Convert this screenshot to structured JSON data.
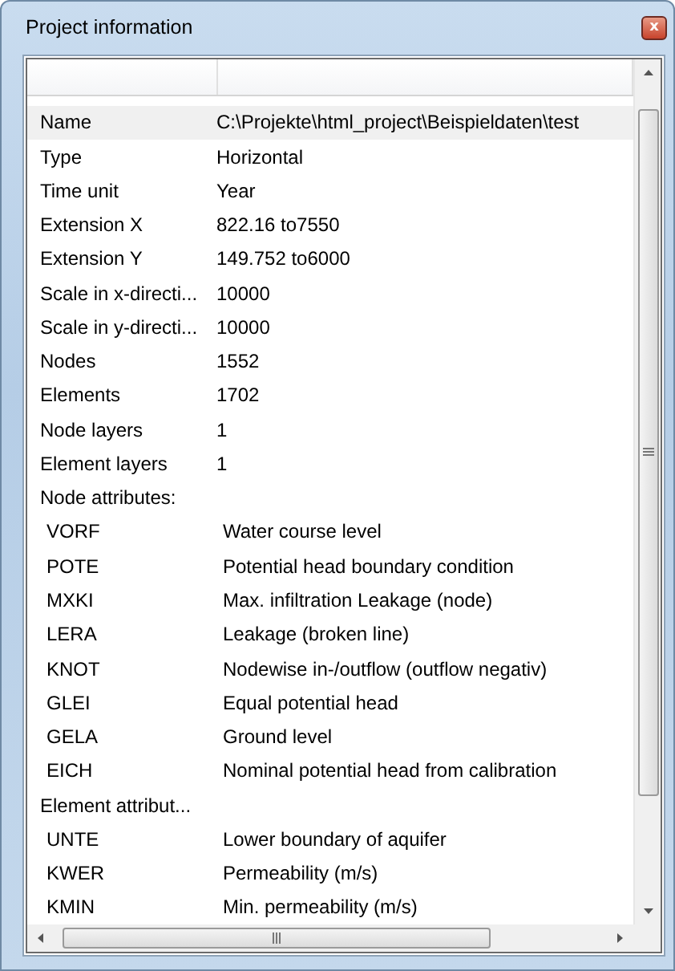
{
  "window": {
    "title": "Project information",
    "close_label": "x"
  },
  "list": {
    "rows": [
      {
        "kind": "property",
        "label": "Name",
        "value": "C:\\Projekte\\html_project\\Beispieldaten\\test",
        "selected": true
      },
      {
        "kind": "property",
        "label": "Type",
        "value": "Horizontal",
        "selected": false
      },
      {
        "kind": "property",
        "label": "Time unit",
        "value": "Year",
        "selected": false
      },
      {
        "kind": "property",
        "label": "Extension X",
        "value": "822.16 to7550",
        "selected": false
      },
      {
        "kind": "property",
        "label": "Extension Y",
        "value": "149.752 to6000",
        "selected": false
      },
      {
        "kind": "property",
        "label": "Scale in x-directi...",
        "value": "10000",
        "selected": false
      },
      {
        "kind": "property",
        "label": "Scale in y-directi...",
        "value": "10000",
        "selected": false
      },
      {
        "kind": "property",
        "label": "Nodes",
        "value": "1552",
        "selected": false
      },
      {
        "kind": "property",
        "label": "Elements",
        "value": "1702",
        "selected": false
      },
      {
        "kind": "property",
        "label": "Node layers",
        "value": "1",
        "selected": false
      },
      {
        "kind": "property",
        "label": "Element layers",
        "value": "1",
        "selected": false
      },
      {
        "kind": "section",
        "label": "Node attributes:",
        "selected": false
      },
      {
        "kind": "attribute",
        "label": "VORF",
        "value": "Water course level",
        "selected": false
      },
      {
        "kind": "attribute",
        "label": "POTE",
        "value": "Potential head boundary condition",
        "selected": false
      },
      {
        "kind": "attribute",
        "label": "MXKI",
        "value": "Max. infiltration Leakage (node)",
        "selected": false
      },
      {
        "kind": "attribute",
        "label": "LERA",
        "value": "Leakage (broken line)",
        "selected": false
      },
      {
        "kind": "attribute",
        "label": "KNOT",
        "value": "Nodewise in-/outflow (outflow negativ)",
        "selected": false
      },
      {
        "kind": "attribute",
        "label": "GLEI",
        "value": "Equal potential head",
        "selected": false
      },
      {
        "kind": "attribute",
        "label": "GELA",
        "value": "Ground level",
        "selected": false
      },
      {
        "kind": "attribute",
        "label": "EICH",
        "value": "Nominal potential head from calibration",
        "selected": false
      },
      {
        "kind": "section",
        "label": "Element attribut...",
        "selected": false
      },
      {
        "kind": "attribute",
        "label": "UNTE",
        "value": "Lower boundary of aquifer",
        "selected": false
      },
      {
        "kind": "attribute",
        "label": "KWER",
        "value": "Permeability (m/s)",
        "selected": false
      },
      {
        "kind": "attribute",
        "label": "KMIN",
        "value": "Min. permeability (m/s)",
        "selected": false
      }
    ]
  }
}
